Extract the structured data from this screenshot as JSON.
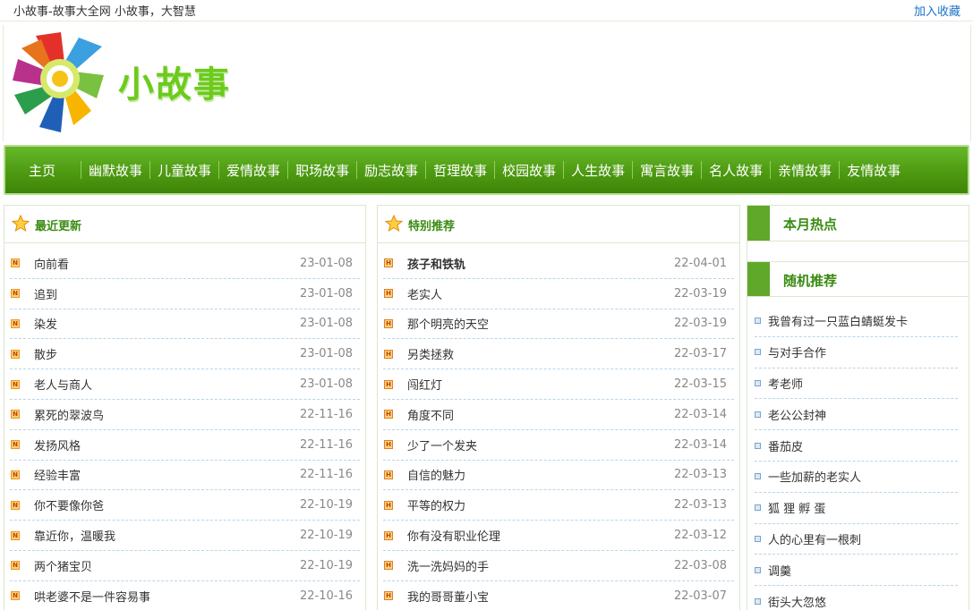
{
  "topbar": {
    "slogan": "小故事-故事大全网 小故事，大智慧",
    "favorite": "加入收藏"
  },
  "header": {
    "logo_text": "小故事"
  },
  "nav": [
    "主页",
    "幽默故事",
    "儿童故事",
    "爱情故事",
    "职场故事",
    "励志故事",
    "哲理故事",
    "校园故事",
    "人生故事",
    "寓言故事",
    "名人故事",
    "亲情故事",
    "友情故事"
  ],
  "latest": {
    "title": "最近更新",
    "items": [
      {
        "title": "向前看",
        "date": "23-01-08"
      },
      {
        "title": "追到",
        "date": "23-01-08"
      },
      {
        "title": "染发",
        "date": "23-01-08"
      },
      {
        "title": "散步",
        "date": "23-01-08"
      },
      {
        "title": "老人与商人",
        "date": "23-01-08"
      },
      {
        "title": "累死的翠波鸟",
        "date": "22-11-16"
      },
      {
        "title": "发扬风格",
        "date": "22-11-16"
      },
      {
        "title": "经验丰富",
        "date": "22-11-16"
      },
      {
        "title": "你不要像你爸",
        "date": "22-10-19"
      },
      {
        "title": "靠近你，温暖我",
        "date": "22-10-19"
      },
      {
        "title": "两个猪宝贝",
        "date": "22-10-19"
      },
      {
        "title": "哄老婆不是一件容易事",
        "date": "22-10-16"
      }
    ]
  },
  "featured": {
    "title": "特别推荐",
    "items": [
      {
        "title": "孩子和铁轨",
        "date": "22-04-01"
      },
      {
        "title": "老实人",
        "date": "22-03-19"
      },
      {
        "title": "那个明亮的天空",
        "date": "22-03-19"
      },
      {
        "title": "另类拯救",
        "date": "22-03-17"
      },
      {
        "title": "闯红灯",
        "date": "22-03-15"
      },
      {
        "title": "角度不同",
        "date": "22-03-14"
      },
      {
        "title": "少了一个发夹",
        "date": "22-03-14"
      },
      {
        "title": "自信的魅力",
        "date": "22-03-13"
      },
      {
        "title": "平等的权力",
        "date": "22-03-13"
      },
      {
        "title": "你有没有职业伦理",
        "date": "22-03-12"
      },
      {
        "title": "洗一洗妈妈的手",
        "date": "22-03-08"
      },
      {
        "title": "我的哥哥董小宝",
        "date": "22-03-07"
      }
    ]
  },
  "hot": {
    "title": "本月热点"
  },
  "random": {
    "title": "随机推荐",
    "items": [
      "我曾有过一只蓝白蜻蜓发卡",
      "与对手合作",
      "考老师",
      "老公公封神",
      "番茄皮",
      "一些加薪的老实人",
      "狐 狸 孵 蛋",
      "人的心里有一根刺",
      "调羹",
      "街头大忽悠"
    ]
  },
  "colors": {
    "nav_green": "#4e9a12",
    "title_green": "#3a8b12",
    "link_blue": "#1a73c8"
  }
}
